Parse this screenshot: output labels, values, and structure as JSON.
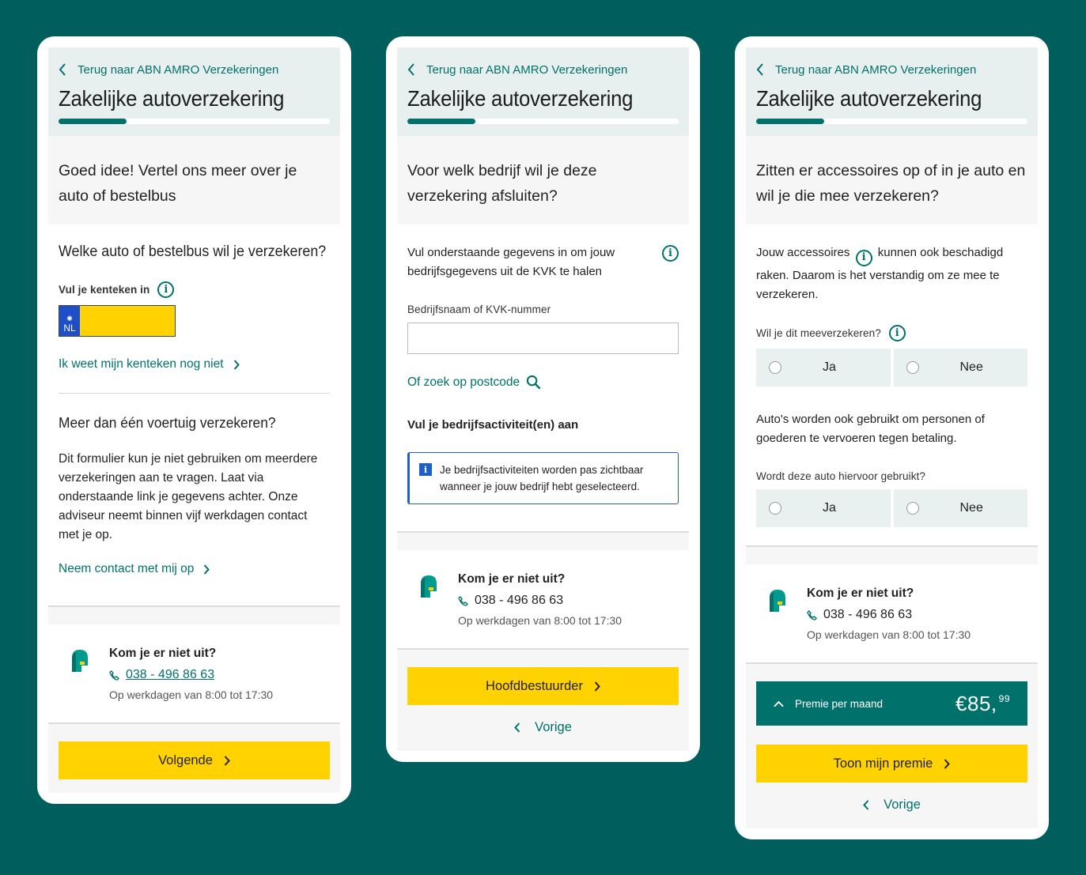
{
  "common": {
    "back_label": "Terug naar ABN AMRO Verzekeringen",
    "title": "Zakelijke autoverzekering",
    "help_title": "Kom je er niet uit?",
    "help_phone": "038 - 496 86 63",
    "help_hours": "Op werkdagen van 8:00 tot 17:30",
    "vorige_label": "Vorige",
    "progress_fraction": 0.25
  },
  "screen1": {
    "intro": "Goed idee! Vertel ons meer over je auto of bestelbus",
    "question": "Welke auto of bestelbus wil je verzekeren?",
    "plate_label": "Vul je kenteken in",
    "plate_country": "NL",
    "unknown_plate_link": "Ik weet mijn kenteken nog niet",
    "multi_title": "Meer dan één voertuig verzekeren?",
    "multi_text": "Dit formulier kun je niet gebruiken om meerdere verzekeringen aan te vragen. Laat via onderstaande link je gegevens achter. Onze adviseur neemt binnen vijf werkdagen contact met je op.",
    "contact_link": "Neem contact met mij op",
    "next_button": "Volgende"
  },
  "screen2": {
    "intro": "Voor welk bedrijf wil je deze verzekering afsluiten?",
    "kvk_text": "Vul onderstaande gegevens in om jouw bedrijfsgegevens uit de KVK te halen",
    "company_label": "Bedrijfsnaam of KVK-nummer",
    "company_value": "",
    "postcode_link": "Of zoek op postcode",
    "activity_label": "Vul je bedrijfsactiviteit(en) aan",
    "activity_notice": "Je bedrijfsactiviteiten worden pas zichtbaar wanneer je jouw bedrijf hebt geselecteerd.",
    "next_button": "Hoofdbestuurder"
  },
  "screen3": {
    "intro": "Zitten er accessoires op of in je auto en wil je die mee verzekeren?",
    "acc_text_a": "Jouw accessoires",
    "acc_text_b": "kunnen ook beschadigd raken. Daarom is het verstandig om ze mee te verzekeren.",
    "q1_label": "Wil je dit meeverzekeren?",
    "yes": "Ja",
    "no": "Nee",
    "transport_text": "Auto's worden ook gebruikt om personen of goederen te vervoeren tegen betaling.",
    "q2_label": "Wordt deze auto hiervoor gebruikt?",
    "premie_label": "Premie per maand",
    "premie_currency": "€",
    "premie_whole": "85,",
    "premie_cents": "99",
    "next_button": "Toon mijn premie"
  }
}
